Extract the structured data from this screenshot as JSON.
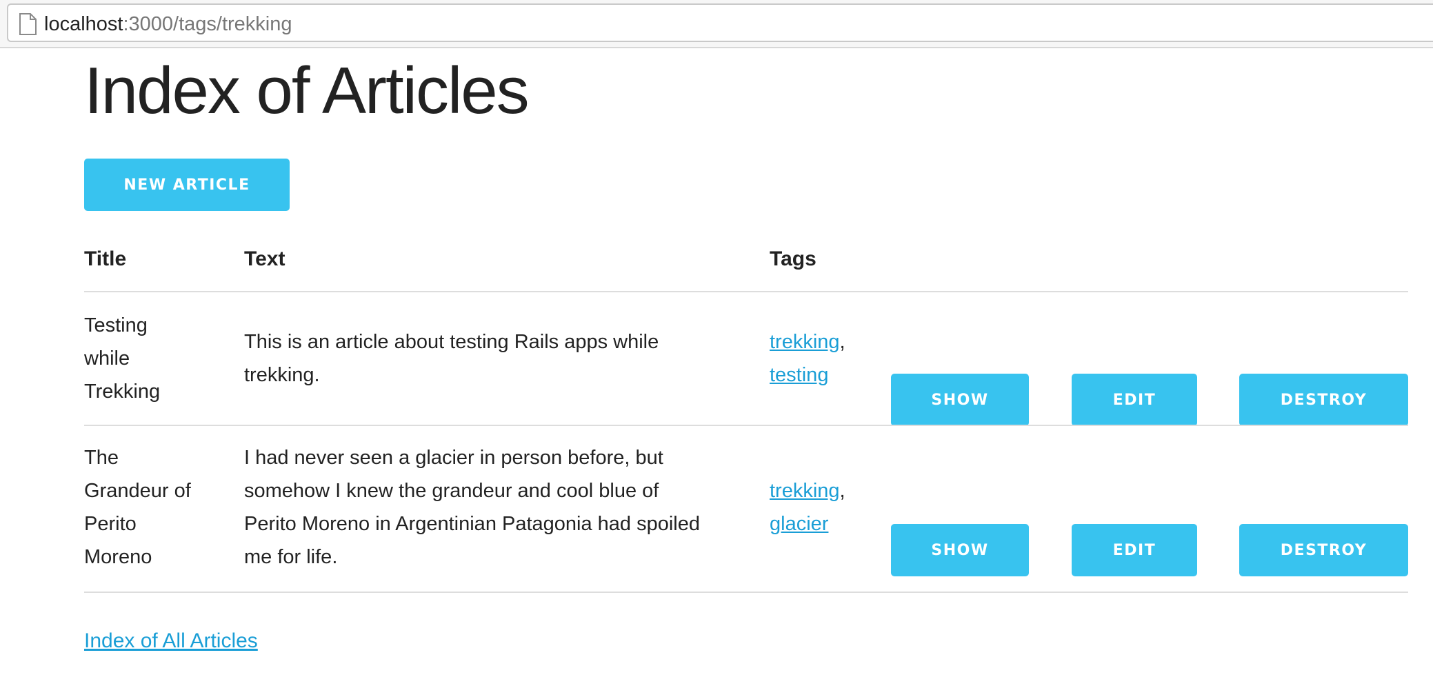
{
  "browser": {
    "url_host": "localhost",
    "url_path": ":3000/tags/trekking",
    "page_icon": "document-icon"
  },
  "page": {
    "title": "Index of Articles",
    "new_article_label": "New Article"
  },
  "table": {
    "headers": {
      "title": "Title",
      "text": "Text",
      "tags": "Tags"
    },
    "rows": [
      {
        "title_lines": [
          "Testing",
          "while",
          "Trekking"
        ],
        "text_lines": [
          "This is an article about testing Rails apps while",
          "trekking."
        ],
        "tags": [
          "trekking",
          "testing"
        ],
        "tag_separator": ",",
        "show_label": "Show",
        "edit_label": "Edit",
        "destroy_label": "Destroy"
      },
      {
        "title_lines": [
          "The",
          "Grandeur of",
          "Perito",
          "Moreno"
        ],
        "text_lines": [
          "I had never seen a glacier in person before, but",
          "somehow I knew the grandeur and cool blue of",
          "Perito Moreno in Argentinian Patagonia had spoiled",
          "me for life."
        ],
        "tags": [
          "trekking",
          "glacier"
        ],
        "tag_separator": ",",
        "show_label": "Show",
        "edit_label": "Edit",
        "destroy_label": "Destroy"
      }
    ]
  },
  "footer": {
    "all_articles_link": "Index of All Articles"
  },
  "colors": {
    "button": "#38c3ef",
    "link": "#1a9ed6",
    "text": "#222222",
    "divider": "#dddddd"
  }
}
